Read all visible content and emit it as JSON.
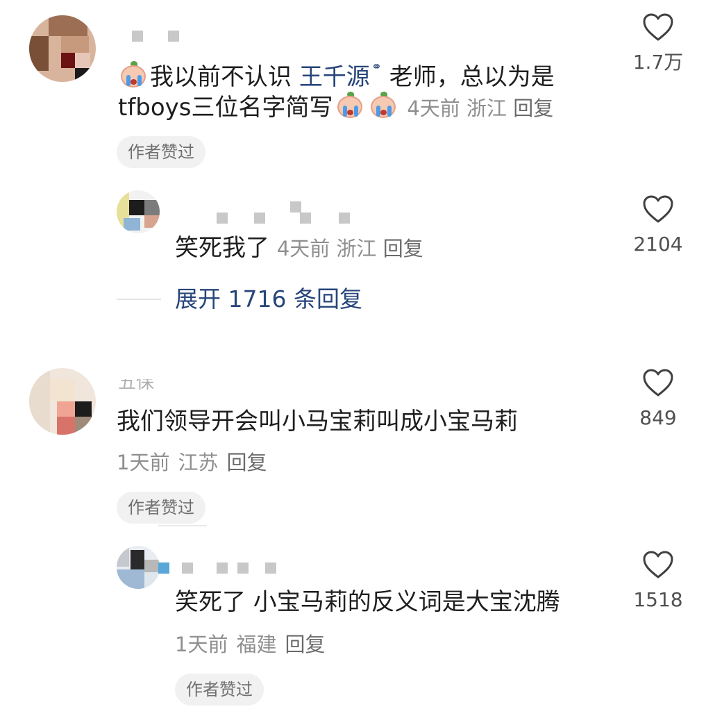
{
  "comments": [
    {
      "text_part1": "我以前不认识 ",
      "link": "王千源",
      "text_part2": " 老师，总以为是",
      "text_line2": "tfboys三位名字简写",
      "time": "4天前",
      "location": "浙江",
      "reply_label": "回复",
      "badge": "作者赞过",
      "likes": "1.7万",
      "reply": {
        "text": "笑死我了",
        "time": "4天前",
        "location": "浙江",
        "reply_label": "回复",
        "likes": "2104"
      },
      "expand_label": "展开 1716 条回复"
    },
    {
      "name_partial": "五保",
      "text": "我们领导开会叫小马宝莉叫成小宝马莉",
      "time": "1天前",
      "location": "江苏",
      "reply_label": "回复",
      "badge": "作者赞过",
      "likes": "849",
      "reply": {
        "text": "笑死了 小宝马莉的反义词是大宝沈腾",
        "time": "1天前",
        "location": "福建",
        "reply_label": "回复",
        "badge": "作者赞过",
        "likes": "1518"
      }
    }
  ],
  "icons": {
    "like": "heart-outline-icon",
    "emoji": "crying-peach-emoji-icon",
    "search_hint": "search-hint-icon"
  },
  "colors": {
    "link": "#27457a",
    "meta": "#8f8f8f",
    "badge_bg": "#f1f1f1"
  }
}
